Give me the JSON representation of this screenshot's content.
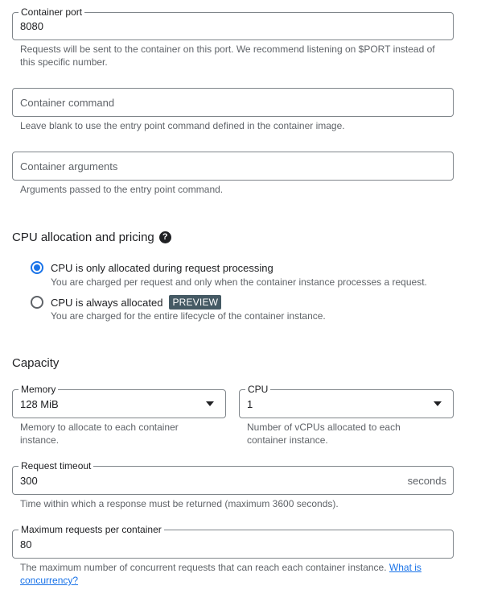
{
  "container_port": {
    "label": "Container port",
    "value": "8080",
    "hint": "Requests will be sent to the container on this port. We recommend listening on $PORT instead of this specific number."
  },
  "container_command": {
    "placeholder": "Container command",
    "hint": "Leave blank to use the entry point command defined in the container image."
  },
  "container_arguments": {
    "placeholder": "Container arguments",
    "hint": "Arguments passed to the entry point command."
  },
  "cpu_allocation": {
    "title": "CPU allocation and pricing",
    "help_icon": "?",
    "options": [
      {
        "label": "CPU is only allocated during request processing",
        "description": "You are charged per request and only when the container instance processes a request.",
        "selected": true
      },
      {
        "label": "CPU is always allocated",
        "badge": "PREVIEW",
        "description": "You are charged for the entire lifecycle of the container instance.",
        "selected": false
      }
    ]
  },
  "capacity": {
    "title": "Capacity",
    "memory": {
      "label": "Memory",
      "value": "128 MiB",
      "hint": "Memory to allocate to each container instance."
    },
    "cpu": {
      "label": "CPU",
      "value": "1",
      "hint": "Number of vCPUs allocated to each container instance."
    },
    "request_timeout": {
      "label": "Request timeout",
      "value": "300",
      "suffix": "seconds",
      "hint": "Time within which a response must be returned (maximum 3600 seconds)."
    },
    "max_requests": {
      "label": "Maximum requests per container",
      "value": "80",
      "hint": "The maximum number of concurrent requests that can reach each container instance.",
      "link": "What is concurrency?"
    }
  },
  "colors": {
    "accent": "#1a73e8",
    "badge": "#455a64",
    "border": "#80868b",
    "hint_text": "#5f6368"
  }
}
